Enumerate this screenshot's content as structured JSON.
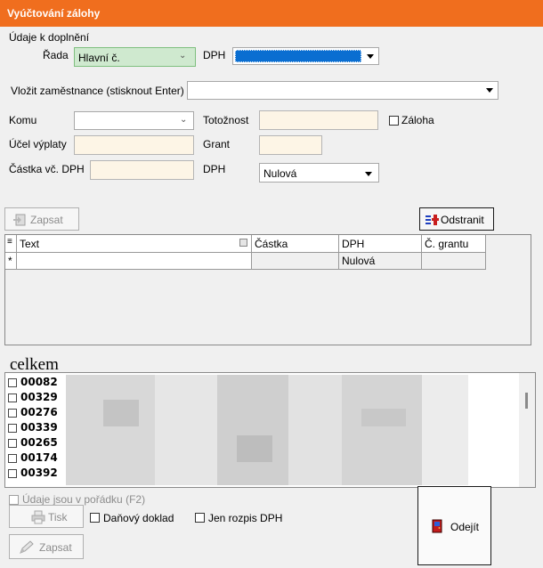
{
  "window": {
    "title": "Vyúčtování zálohy"
  },
  "section": {
    "title": "Údaje k doplnění"
  },
  "form": {
    "rada_label": "Řada",
    "rada_value": "Hlavní č.",
    "dph_top_label": "DPH",
    "vlozit_label": "Vložit zaměstnance (stisknout Enter)",
    "komu_label": "Komu",
    "totoznost_label": "Totožnost",
    "zaloha_label": "Záloha",
    "ucel_label": "Účel výplaty",
    "grant_label": "Grant",
    "castka_label": "Částka vč. DPH",
    "dph_label": "DPH",
    "dph_value": "Nulová"
  },
  "toolbar": {
    "zapsat_label": "Zapsat",
    "odstranit_label": "Odstranit"
  },
  "grid": {
    "columns": [
      "Text",
      "Částka",
      "DPH",
      "Č. grantu"
    ],
    "new_row_marker": "*",
    "new_row_dph": "Nulová"
  },
  "summary": {
    "title": "celkem"
  },
  "list": {
    "items": [
      "00082",
      "00329",
      "00276",
      "00339",
      "00265",
      "00174",
      "00392"
    ]
  },
  "footer": {
    "udaje_label": "Údaje jsou v pořádku (F2)",
    "tisk_label": "Tisk",
    "danovy_label": "Daňový doklad",
    "rozpis_label": "Jen rozpis DPH",
    "zapsat_label": "Zapsat",
    "odejit_label": "Odejít"
  }
}
